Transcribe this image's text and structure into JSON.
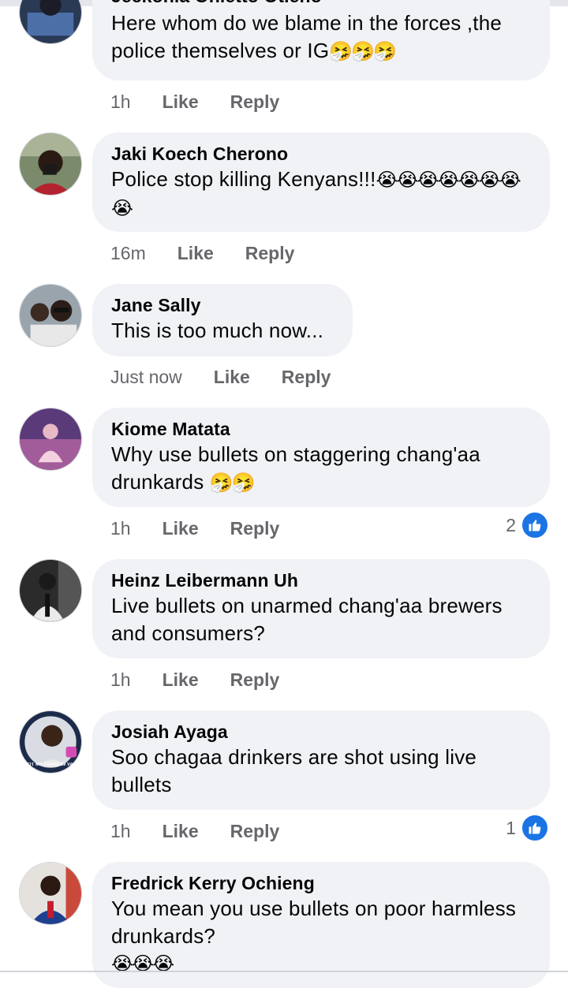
{
  "comments": [
    {
      "name": "Jeckonia Onietto Otieno",
      "text": "Here whom do we blame in the forces ,the police themselves or IG",
      "emoji": "🤧🤧🤧",
      "time": "1h",
      "like": "Like",
      "reply": "Reply",
      "reactions": ""
    },
    {
      "name": "Jaki Koech Cherono",
      "text": "Police stop killing Kenyans!!!",
      "emoji": "😭😭😭😭😭😭😭😭",
      "time": "16m",
      "like": "Like",
      "reply": "Reply",
      "reactions": ""
    },
    {
      "name": "Jane Sally",
      "text": "This is too much now...",
      "emoji": "",
      "time": "Just now",
      "like": "Like",
      "reply": "Reply",
      "reactions": ""
    },
    {
      "name": "Kiome Matata",
      "text": "Why use bullets on staggering chang'aa drunkards",
      "emoji": "🤧🤧",
      "time": "1h",
      "like": "Like",
      "reply": "Reply",
      "reactions": "2"
    },
    {
      "name": "Heinz Leibermann Uh",
      "text": "Live bullets on unarmed chang'aa brewers and consumers?",
      "emoji": "",
      "time": "1h",
      "like": "Like",
      "reply": "Reply",
      "reactions": ""
    },
    {
      "name": "Josiah Ayaga",
      "text": "Soo chagaa drinkers are shot using live bullets",
      "emoji": "",
      "time": "1h",
      "like": "Like",
      "reply": "Reply",
      "reactions": "1"
    },
    {
      "name": "Fredrick Kerry Ochieng",
      "text": "You mean you use bullets on poor harmless drunkards?",
      "emoji": "😭😭😭",
      "time": "",
      "like": "",
      "reply": "",
      "reactions": ""
    }
  ],
  "avatar_badge": "I GOT MY COVID-19 VACCINE",
  "colors": {
    "bubble": "#f0f2f5",
    "meta": "#65676b",
    "like_blue": "#1b74e4",
    "text": "#050505"
  }
}
